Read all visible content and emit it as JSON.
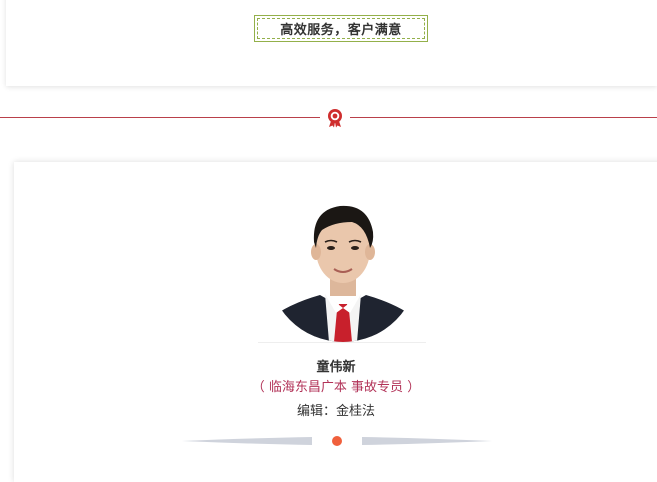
{
  "slogan": "高效服务，客户满意",
  "profile": {
    "name": "童伟新",
    "position": "（ 临海东昌广本   事故专员 ）",
    "editor": "编辑：金桂法"
  },
  "icons": {
    "divider": "rosette-badge-icon",
    "footer": "dot-divider-icon"
  },
  "colors": {
    "accent_red": "#b9404a",
    "position_text": "#b23358",
    "frame_green": "#93b04a",
    "dot": "#f0603c"
  }
}
